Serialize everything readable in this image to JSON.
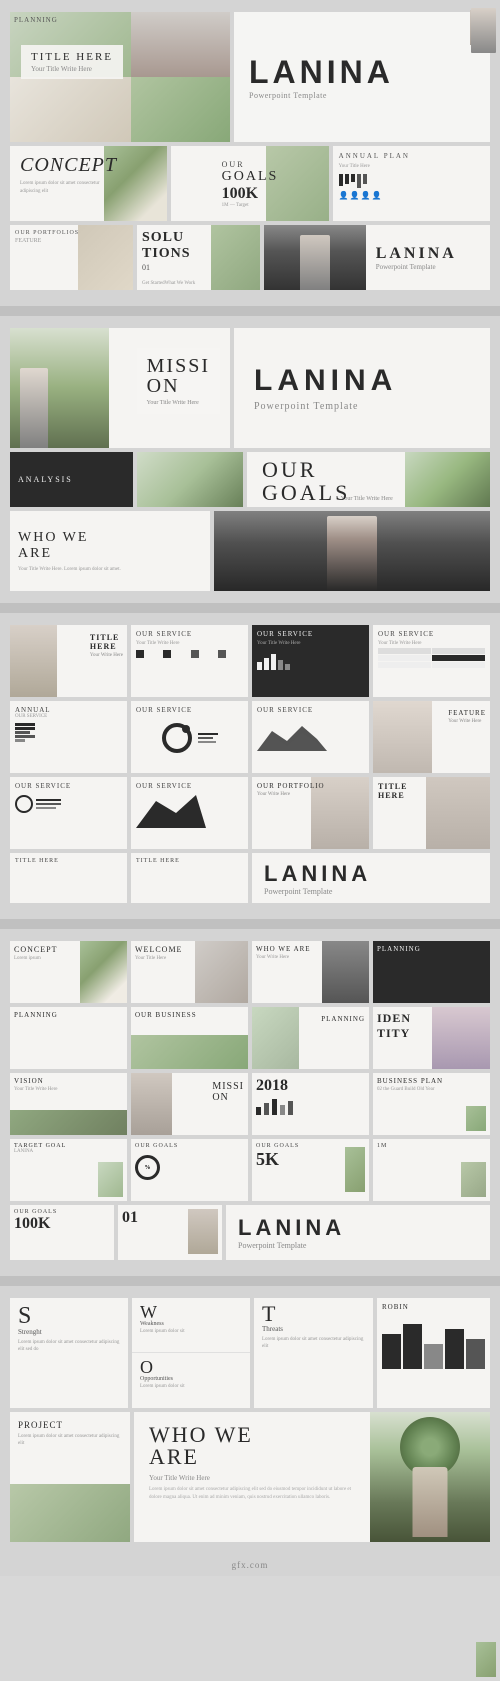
{
  "brand": {
    "name": "LANINA",
    "tagline": "Powerpoint Template"
  },
  "section1": {
    "title_slide": {
      "title": "TITLE HERE",
      "subtitle": "Your Title Write Here"
    },
    "concept_slide": {
      "text": "CONCEPT",
      "description": "Lorem ipsum dolor sit amet consectetur"
    },
    "slides": [
      {
        "label": "OUR GOALS",
        "sub": "100K"
      },
      {
        "label": "ANNUAL PLAN",
        "sub": "Your Title Here"
      },
      {
        "label": "SOLUTIONS",
        "sub": "01"
      },
      {
        "label": "OUR PORTFOLIOS",
        "sub": "FEATURE"
      },
      {
        "label": "PLANNING",
        "sub": ""
      },
      {
        "label": "01",
        "sub": ""
      }
    ]
  },
  "section2": {
    "mission_slide": {
      "text1": "MISSI",
      "text2": "ON",
      "sub": "Your Title Write Here"
    },
    "goals_slide": {
      "text1": "OUR",
      "text2": "GOALS",
      "sub": "Your Title Write Here"
    },
    "who_slide": {
      "text1": "WHO WE",
      "text2": "ARE"
    },
    "analysis_label": "ANALYSIS"
  },
  "section3": {
    "slides": [
      {
        "label": "TITLE HERE",
        "sub": ""
      },
      {
        "label": "OUR SERVICE",
        "sub": ""
      },
      {
        "label": "OUR SERVICE",
        "sub": ""
      },
      {
        "label": "OUR SERVICE",
        "sub": ""
      },
      {
        "label": "ANNUAL",
        "sub": "OUR SERVICE"
      },
      {
        "label": "OUR SERVICE",
        "sub": "FEATURE"
      },
      {
        "label": "OUR SERVICE",
        "sub": ""
      },
      {
        "label": "OUR PORTFOLIO",
        "sub": ""
      },
      {
        "label": "TITLE HERE",
        "sub": ""
      },
      {
        "label": "TITLE HERE",
        "sub": ""
      },
      {
        "label": "FEATURE",
        "sub": ""
      },
      {
        "label": "TITLE HERE",
        "sub": ""
      }
    ]
  },
  "section4": {
    "lanina_brand": "LANINA",
    "lanina_tagline": "Powerpoint Template",
    "slides": [
      {
        "label": "CONCEPT",
        "sub": ""
      },
      {
        "label": "WELCOME",
        "sub": ""
      },
      {
        "label": "WHO WE ARE",
        "sub": ""
      },
      {
        "label": "PLANNING",
        "sub": ""
      },
      {
        "label": "OUR BUSINESS",
        "sub": ""
      },
      {
        "label": "PLANNING",
        "sub": ""
      },
      {
        "label": "IDENTITY",
        "sub": ""
      },
      {
        "label": "VISION",
        "sub": ""
      },
      {
        "label": "MISSION ON",
        "sub": ""
      },
      {
        "label": "2018",
        "sub": ""
      },
      {
        "label": "BUSINESS PLAN",
        "sub": ""
      },
      {
        "label": "TARGET GOAL",
        "sub": "LANINA"
      },
      {
        "label": "OUR GOALS",
        "sub": ""
      },
      {
        "label": "OUR GOALS",
        "sub": "5K"
      },
      {
        "label": "1M",
        "sub": ""
      },
      {
        "label": "OUR GOALS",
        "sub": "100K"
      },
      {
        "label": "01",
        "sub": ""
      }
    ]
  },
  "section5": {
    "swot": {
      "s": {
        "letter": "S",
        "word": "Strenght"
      },
      "w": {
        "letter": "W",
        "word": "Weakness"
      },
      "o": {
        "letter": "O",
        "word": "Opportunities"
      },
      "t": {
        "letter": "T",
        "word": "Threats"
      }
    },
    "robin_label": "ROBIN",
    "project_label": "PROJECT",
    "who_label1": "WHO WE",
    "who_label2": "ARE",
    "who_sub": "Your Title Write Here"
  },
  "watermark": {
    "text": "gfx.com"
  }
}
